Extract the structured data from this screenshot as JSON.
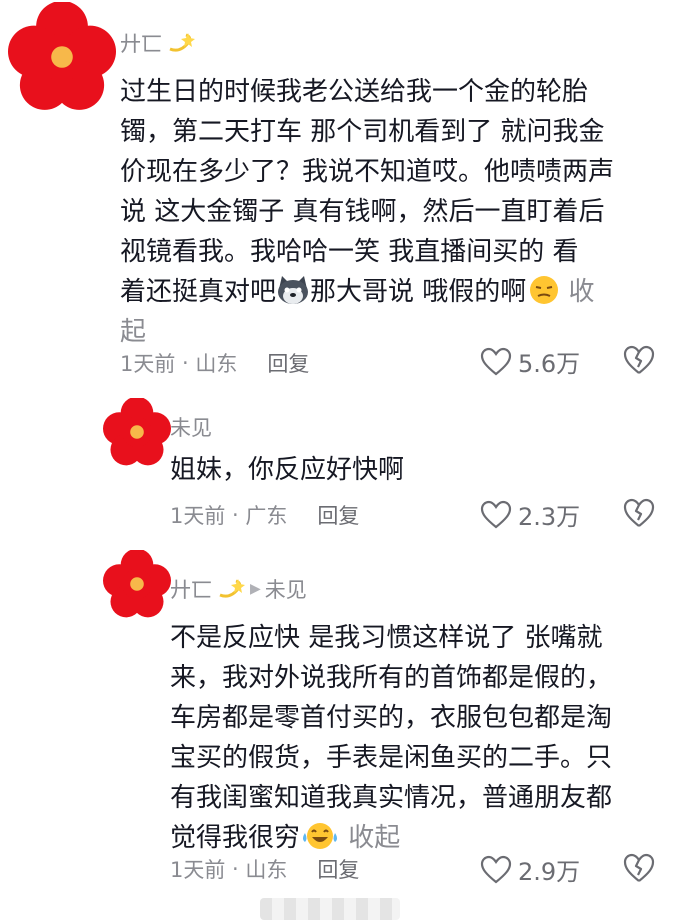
{
  "colors": {
    "avatar_red": "#e8101c",
    "avatar_center": "#f7b84a",
    "meta_gray": "#8a8b91"
  },
  "comments": [
    {
      "username": "廾匸",
      "username_emoji": "dizzy-sparkle-icon",
      "lines": [
        "过生日的时候我老公送给我一个金的轮胎",
        "镯，第二天打车  那个司机看到了 就问我金",
        "价现在多少了？我说不知道哎。他啧啧两声",
        "说 这大金镯子 真有钱啊，然后一直盯着后",
        "视镜看我。我哈哈一笑  我直播间买的  看"
      ],
      "line6_pre": "着还挺真对吧",
      "line6_post": "那大哥说   哦假的啊",
      "collapse_first": "收",
      "collapse_second": "起",
      "time": "1天前",
      "location": "山东",
      "reply": "回复",
      "likes": "5.6万"
    },
    {
      "username": "未见",
      "text": "姐妹，你反应好快啊",
      "time": "1天前",
      "location": "广东",
      "reply": "回复",
      "likes": "2.3万"
    },
    {
      "username": "廾匸",
      "reply_to": "未见",
      "lines": [
        "不是反应快 是我习惯这样说了 张嘴就",
        "来，我对外说我所有的首饰都是假的，",
        "车房都是零首付买的，衣服包包都是淘",
        "宝买的假货，手表是闲鱼买的二手。只",
        "有我闺蜜知道我真实情况，普通朋友都"
      ],
      "last_pre": "觉得我很穷",
      "collapse": "收起",
      "time": "1天前",
      "location": "山东",
      "reply": "回复",
      "likes": "2.9万"
    }
  ]
}
